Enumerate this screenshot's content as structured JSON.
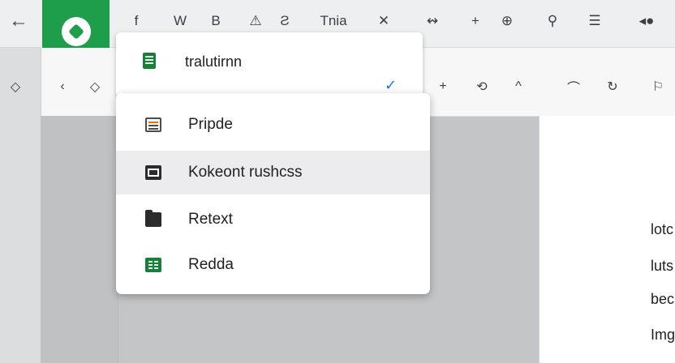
{
  "toolbar": {
    "back_icon": "arrow-left-icon",
    "items": [
      {
        "label": "f"
      },
      {
        "label": "W"
      },
      {
        "label": "B"
      },
      {
        "label": "⚠"
      },
      {
        "label": "Ƨ"
      },
      {
        "label": "Tnia"
      },
      {
        "label": "✕"
      },
      {
        "label": "↭"
      },
      {
        "label": "+"
      },
      {
        "label": "⊕"
      },
      {
        "label": "⚲"
      },
      {
        "label": "☰"
      },
      {
        "label": "◂●"
      }
    ]
  },
  "subbar": {
    "items": [
      {
        "label": "◇"
      },
      {
        "label": "‹"
      },
      {
        "label": "◇"
      },
      {
        "label": "+"
      },
      {
        "label": "⟲"
      },
      {
        "label": "^"
      },
      {
        "label": "⌒"
      },
      {
        "label": "↻"
      },
      {
        "label": "⚐"
      }
    ]
  },
  "top_menu": {
    "title": "tralutirnn",
    "check": "✓"
  },
  "menu": {
    "items": [
      {
        "label": "Pripde",
        "icon": "document-icon"
      },
      {
        "label": "Kokeont rushcss",
        "icon": "slides-icon",
        "selected": true
      },
      {
        "label": "Retext",
        "icon": "folder-icon"
      },
      {
        "label": "Redda",
        "icon": "spreadsheet-icon"
      }
    ]
  },
  "document": {
    "lines": [
      "lotc",
      "luts",
      "bec",
      "Img"
    ]
  },
  "colors": {
    "accent": "#1e9e4a",
    "selection": "#ececee",
    "check": "#1a73e8"
  }
}
